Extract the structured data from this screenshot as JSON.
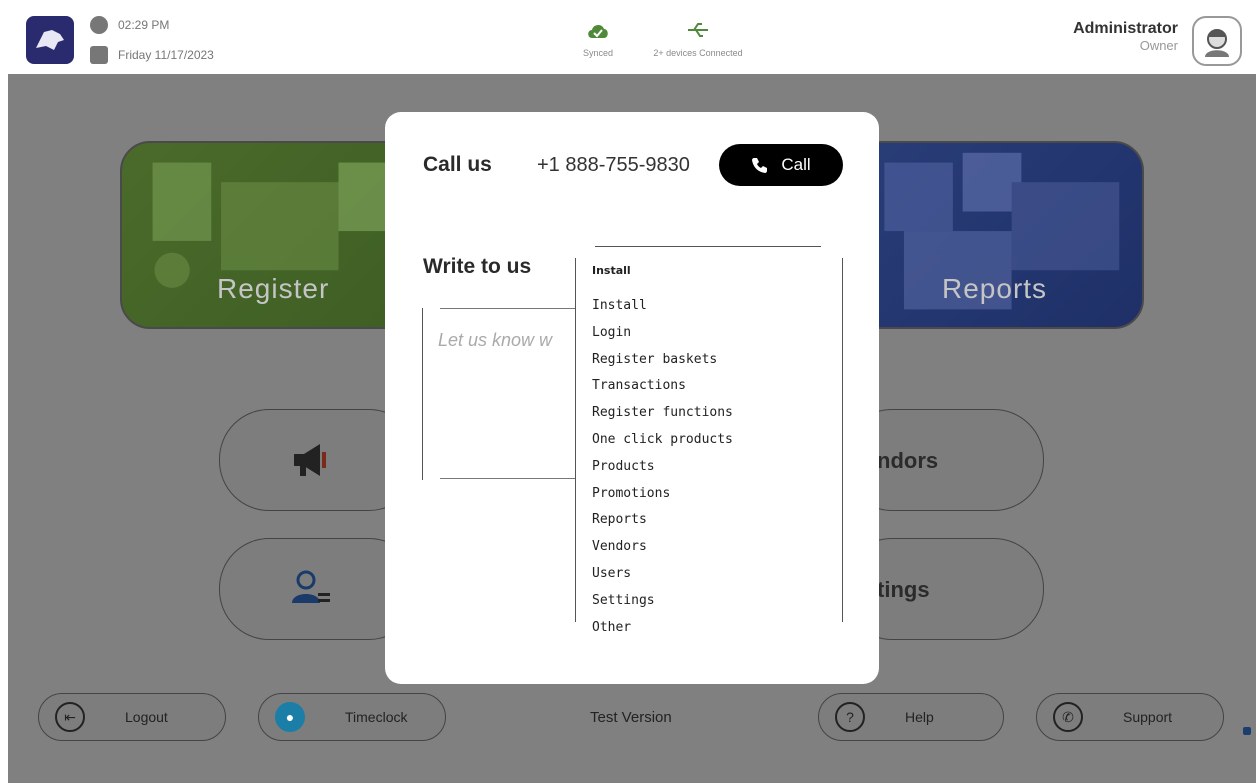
{
  "header": {
    "time": "02:29 PM",
    "date": "Friday 11/17/2023",
    "sync_status": "Synced",
    "devices_status": "2+ devices Connected",
    "user_name": "Administrator",
    "user_role": "Owner"
  },
  "tiles": {
    "register_label": "Register",
    "reports_label": "Reports"
  },
  "menu": {
    "vendors_partial": "ndors",
    "settings_partial": "tings"
  },
  "bottom_bar": {
    "logout_label": "Logout",
    "timeclock_label": "Timeclock",
    "version_label": "Test Version",
    "help_label": "Help",
    "support_label": "Support"
  },
  "support_modal": {
    "call_title": "Call us",
    "phone_number": "+1 888-755-9830",
    "call_button_label": "Call",
    "write_title": "Write to us",
    "message_placeholder": "Let us know w",
    "topic_selected": "Install",
    "topic_options": [
      "Install",
      "Login",
      "Register baskets",
      "Transactions",
      "Register functions",
      "One click products",
      "Products",
      "Promotions",
      "Reports",
      "Vendors",
      "Users",
      "Settings",
      "Other"
    ]
  },
  "colors": {
    "register_tile": "#4a6b2a",
    "reports_tile": "#293d78",
    "overlay": "#808080",
    "call_button": "#000000",
    "timeclock_icon": "#1b7ea6"
  }
}
